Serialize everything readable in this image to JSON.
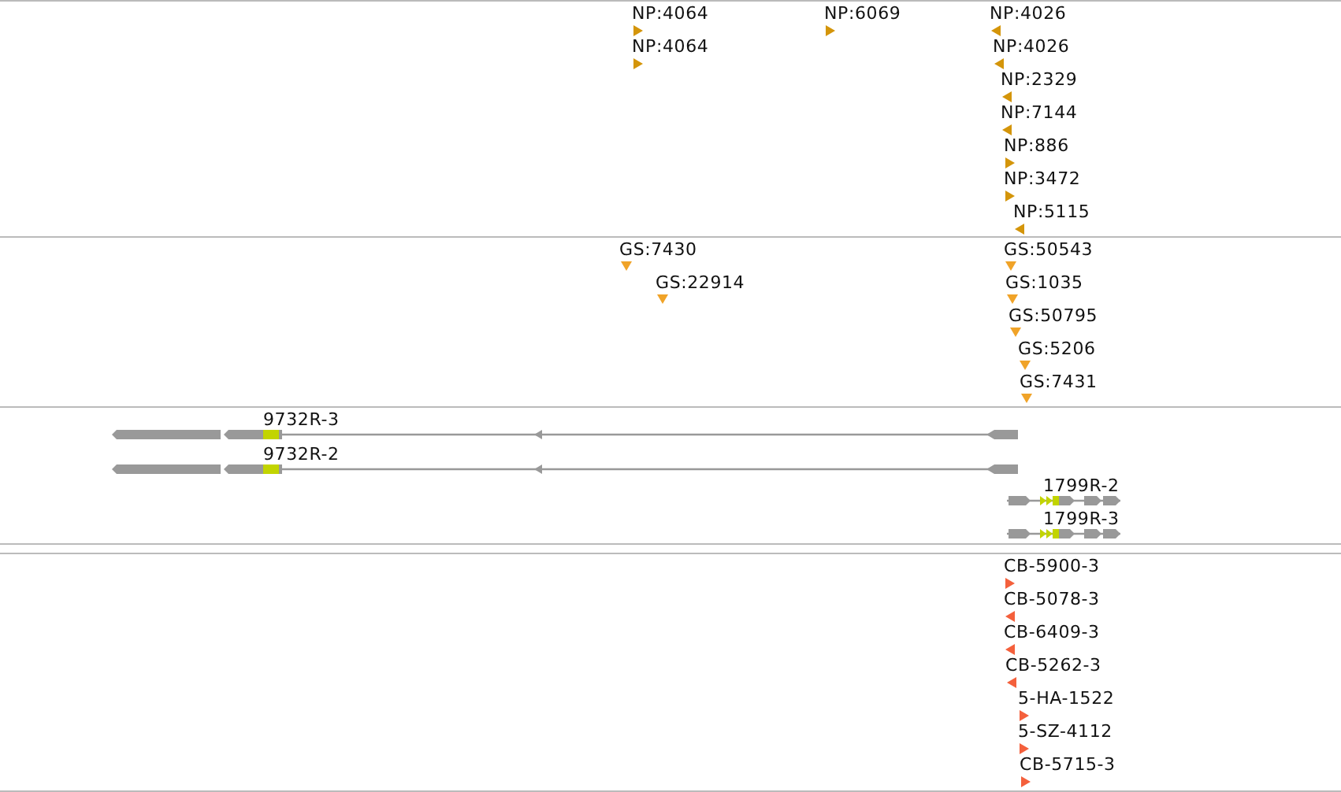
{
  "tracks": [
    {
      "kind": "markers",
      "color": "#d4950a",
      "features": [
        {
          "label": "NP:4064",
          "kind": "forward"
        },
        {
          "label": "NP:6069",
          "kind": "forward"
        },
        {
          "label": "NP:4026",
          "kind": "reverse"
        },
        {
          "label": "NP:4064",
          "kind": "forward"
        },
        {
          "label": "NP:4026",
          "kind": "reverse"
        },
        {
          "label": "NP:2329",
          "kind": "reverse"
        },
        {
          "label": "NP:7144",
          "kind": "reverse"
        },
        {
          "label": "NP:886",
          "kind": "forward"
        },
        {
          "label": "NP:3472",
          "kind": "forward"
        },
        {
          "label": "NP:5115",
          "kind": "reverse"
        }
      ]
    },
    {
      "kind": "markers",
      "color": "#f0a328",
      "features": [
        {
          "label": "GS:7430",
          "kind": "point"
        },
        {
          "label": "GS:50543",
          "kind": "point"
        },
        {
          "label": "GS:22914",
          "kind": "point"
        },
        {
          "label": "GS:1035",
          "kind": "point"
        },
        {
          "label": "GS:50795",
          "kind": "point"
        },
        {
          "label": "GS:5206",
          "kind": "point"
        },
        {
          "label": "GS:7431",
          "kind": "point"
        }
      ]
    },
    {
      "kind": "genes",
      "features": [
        {
          "label": "9732R-3",
          "kind": "reverse"
        },
        {
          "label": "9732R-2",
          "kind": "reverse"
        },
        {
          "label": "1799R-2",
          "kind": "forward"
        },
        {
          "label": "1799R-3",
          "kind": "forward"
        }
      ]
    },
    {
      "kind": "markers",
      "color": "#f4603c",
      "features": [
        {
          "label": "CB-5900-3",
          "kind": "forward"
        },
        {
          "label": "CB-5078-3",
          "kind": "reverse"
        },
        {
          "label": "CB-6409-3",
          "kind": "reverse"
        },
        {
          "label": "CB-5262-3",
          "kind": "reverse"
        },
        {
          "label": "5-HA-1522",
          "kind": "forward"
        },
        {
          "label": "5-SZ-4112",
          "kind": "forward"
        },
        {
          "label": "CB-5715-3",
          "kind": "forward"
        }
      ]
    }
  ]
}
